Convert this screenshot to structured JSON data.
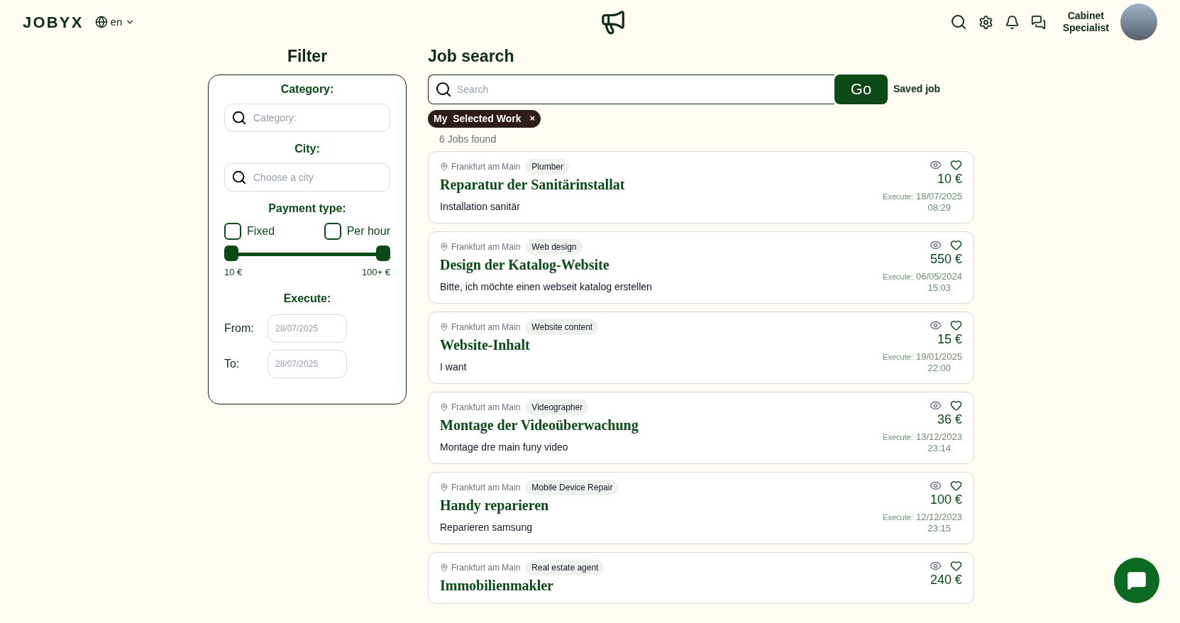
{
  "header": {
    "logo": "JOBYX",
    "language": "en",
    "user": {
      "line1": "Cabinet",
      "line2": "Specialist"
    }
  },
  "filter": {
    "title": "Filter",
    "category": {
      "label": "Category:",
      "placeholder": "Category:"
    },
    "city": {
      "label": "City:",
      "placeholder": "Choose a city"
    },
    "payment": {
      "label": "Payment type:",
      "options": [
        {
          "label": "Fixed",
          "checked": false
        },
        {
          "label": "Per hour",
          "checked": false
        }
      ]
    },
    "price_range": {
      "thumbs": [
        {
          "level": 0
        },
        {
          "level": 1
        }
      ],
      "min_label": "10 €",
      "max_label": "100+ €"
    },
    "execute": {
      "label": "Execute:",
      "from": {
        "label": "From:",
        "placeholder": "28/07/2025"
      },
      "to": {
        "label": "To:",
        "placeholder": "28/07/2025"
      }
    }
  },
  "search": {
    "title": "Job search",
    "placeholder": "Search",
    "go": "Go",
    "saved": "Saved job",
    "chips": [
      {
        "label": "My  Selected Work",
        "remove": "×"
      }
    ],
    "count": "6 Jobs found"
  },
  "jobs": [
    {
      "city": "Frankfurt am Main",
      "tag": "Plumber",
      "title": "Reparatur der Sanitärinstallat",
      "price": "10 €",
      "description": "Installation sanitär",
      "execute_label": "Execute:",
      "date": "18/07/2025",
      "time": "08:29"
    },
    {
      "city": "Frankfurt am Main",
      "tag": "Web design",
      "title": "Design der Katalog-Website",
      "price": "550 €",
      "description": "Bitte, ich möchte einen webseit katalog erstellen",
      "execute_label": "Execute:",
      "date": "06/05/2024",
      "time": "15:03"
    },
    {
      "city": "Frankfurt am Main",
      "tag": "Website content",
      "title": "Website-Inhalt",
      "price": "15 €",
      "description": "I want",
      "execute_label": "Execute:",
      "date": "19/01/2025",
      "time": "22:00"
    },
    {
      "city": "Frankfurt am Main",
      "tag": "Videographer",
      "title": "Montage der Videoüberwachung",
      "price": "36 €",
      "description": "Montage dre main funy video",
      "execute_label": "Execute:",
      "date": "13/12/2023",
      "time": "23:14"
    },
    {
      "city": "Frankfurt am Main",
      "tag": "Mobile Device Repair",
      "title": "Handy reparieren",
      "price": "100 €",
      "description": "Reparieren samsung",
      "execute_label": "Execute:",
      "date": "12/12/2023",
      "time": "23:15"
    },
    {
      "city": "Frankfurt am Main",
      "tag": "Real estate agent",
      "title": "Immobilienmakler",
      "price": "240 €"
    }
  ]
}
